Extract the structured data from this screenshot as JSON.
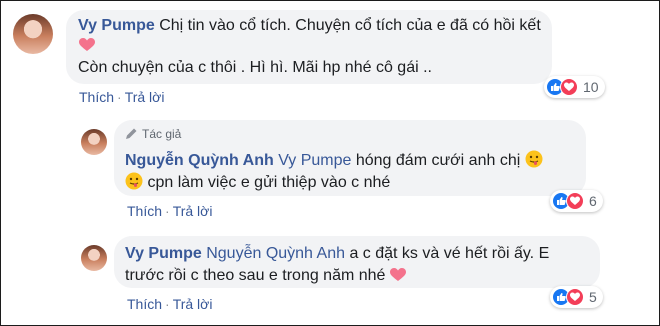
{
  "comments": [
    {
      "author": "Vy Pumpe",
      "text_line1": "Chị tin vào cổ tích. Chuyện cổ tích của e đã có hồi kết",
      "text_line2": "Còn chuyện của c thôi . Hì hì. Mãi hp nhé cô gái ..",
      "like_label": "Thích",
      "reply_label": "Trả lời",
      "reaction_count": "10"
    },
    {
      "author_tag": "Tác giả",
      "author": "Nguyễn Quỳnh Anh",
      "mention": "Vy Pumpe",
      "text_line1": "hóng đám cưới anh chị",
      "text_line2": "cpn làm việc e gửi thiệp vào c nhé",
      "like_label": "Thích",
      "reply_label": "Trả lời",
      "reaction_count": "6"
    },
    {
      "author": "Vy Pumpe",
      "mention": "Nguyễn Quỳnh Anh",
      "text_line1": "a c đặt ks và vé hết rồi ấy. E",
      "text_line2": "trước rồi c theo sau e trong năm nhé",
      "like_label": "Thích",
      "reply_label": "Trả lời",
      "reaction_count": "5"
    }
  ],
  "separator": "·",
  "colors": {
    "link": "#385898",
    "bubble": "#f2f3f5",
    "like": "#1877f2",
    "love": "#f33e58"
  },
  "icons": [
    "avatar",
    "heart-emoji-icon",
    "tongue-out-emoji-icon",
    "like-reaction-icon",
    "love-reaction-icon",
    "author-pen-icon"
  ]
}
